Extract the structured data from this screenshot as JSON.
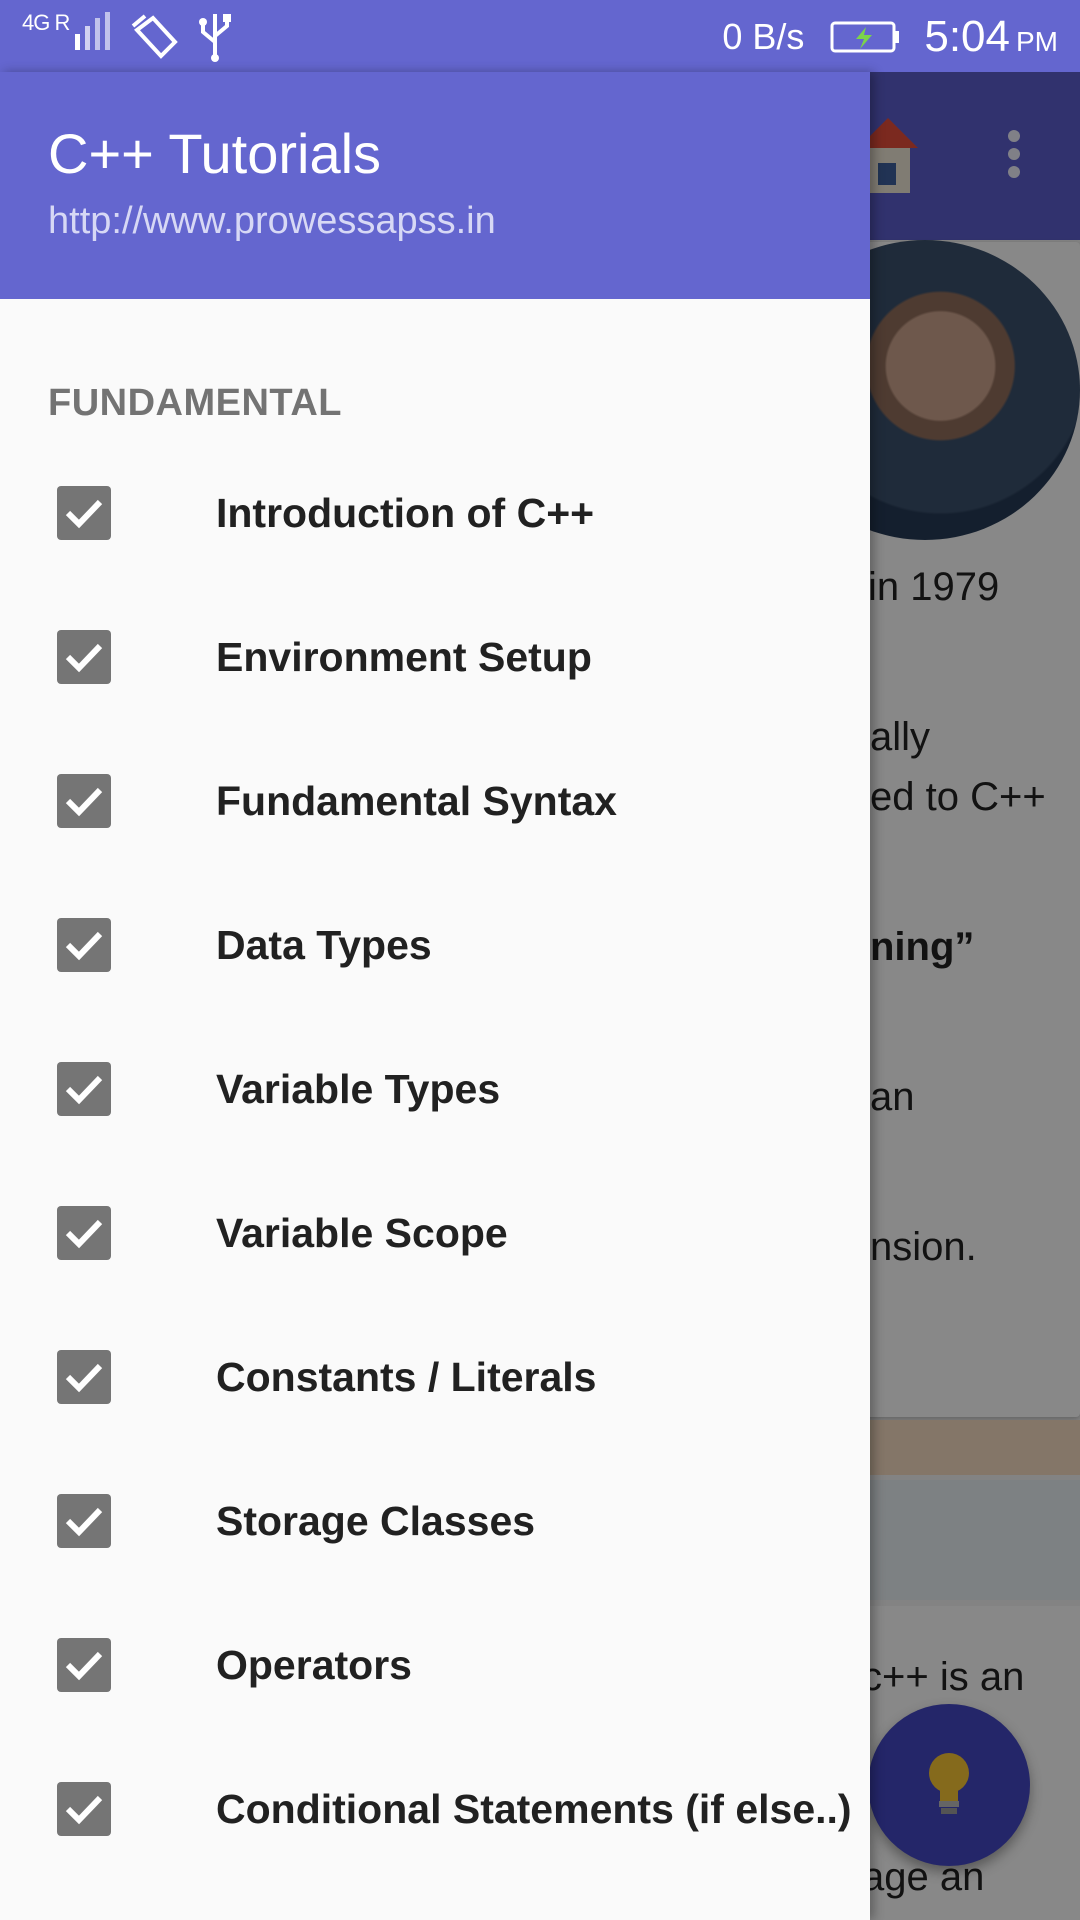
{
  "status_bar": {
    "network": "4G R",
    "speed": "0 B/s",
    "time": "5:04",
    "ampm": "PM",
    "icons": [
      "signal-icon",
      "cleaner-icon",
      "usb-icon",
      "battery-charging-icon"
    ]
  },
  "drawer": {
    "title": "C++ Tutorials",
    "url": "http://www.prowessapss.in",
    "section": "FUNDAMENTAL",
    "items": [
      {
        "label": "Introduction of C++",
        "checked": true
      },
      {
        "label": "Environment Setup",
        "checked": true
      },
      {
        "label": "Fundamental Syntax",
        "checked": true
      },
      {
        "label": "Data Types",
        "checked": true
      },
      {
        "label": "Variable Types",
        "checked": true
      },
      {
        "label": "Variable Scope",
        "checked": true
      },
      {
        "label": "Constants / Literals",
        "checked": true
      },
      {
        "label": "Storage Classes",
        "checked": true
      },
      {
        "label": "Operators",
        "checked": true
      },
      {
        "label": "Conditional Statements (if else..)",
        "checked": true
      }
    ]
  },
  "background": {
    "line1": "in 1979",
    "line2": "ally",
    "line3": "ed to C++",
    "line4": "ning”",
    "line5": "an",
    "line6": "nsion.",
    "line7": "c++ is an",
    "line8": "age an",
    "icons": [
      "home-icon",
      "more-vert-icon",
      "lightbulb-icon"
    ]
  },
  "colors": {
    "primary": "#6466cf",
    "toolbar": "#5a5cc8",
    "fab": "#4346c0",
    "checkbox": "#757575"
  }
}
